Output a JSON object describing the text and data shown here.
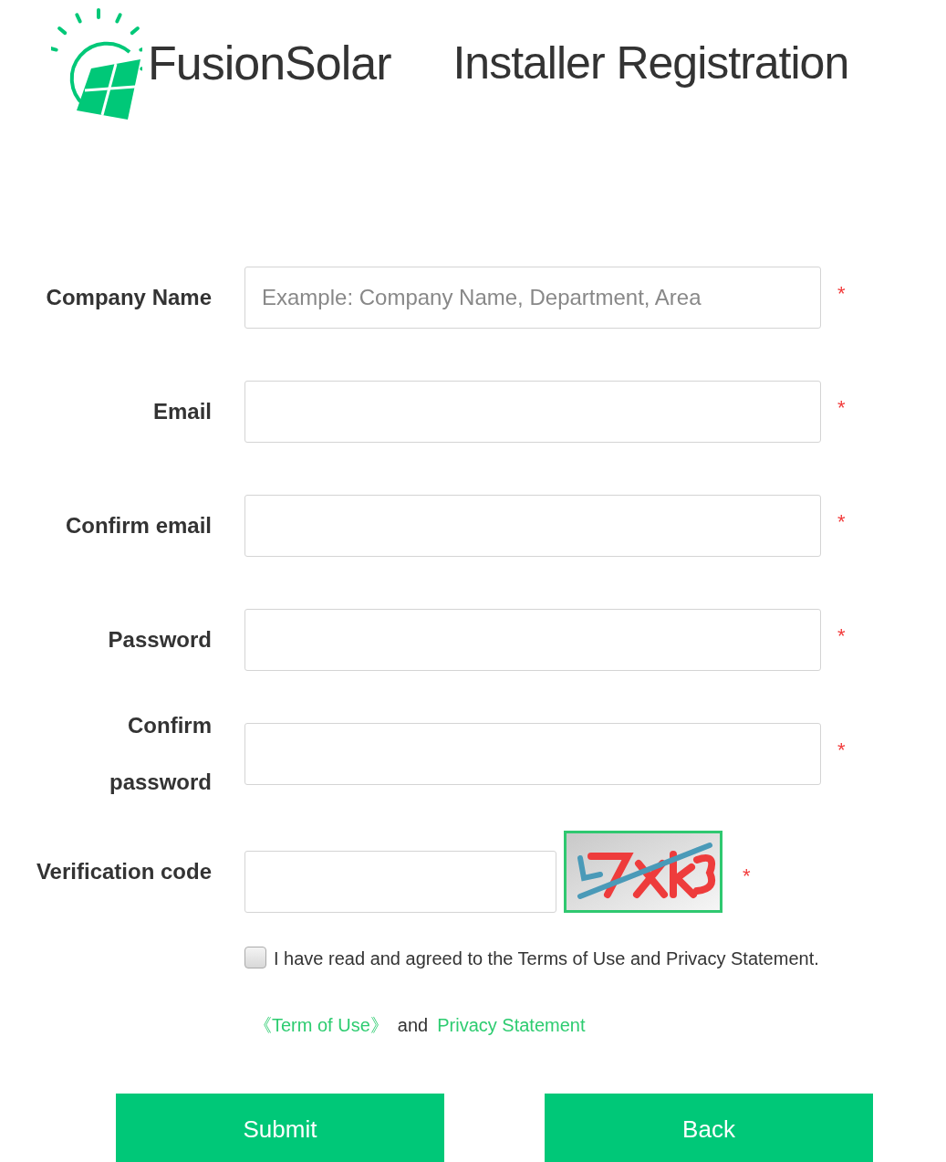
{
  "header": {
    "brand": "FusionSolar",
    "title": "Installer Registration"
  },
  "fields": [
    {
      "label": "Company Name",
      "placeholder": "Example: Company Name, Department, Area",
      "required_mark": "*"
    },
    {
      "label": "Email",
      "required_mark": "*"
    },
    {
      "label": "Confirm email",
      "required_mark": "*"
    },
    {
      "label": "Password",
      "required_mark": "*"
    },
    {
      "label": "Confirm password",
      "required_mark": "*"
    }
  ],
  "verification": {
    "label": "Verification code",
    "required_mark": "*"
  },
  "agreement": {
    "checked": false,
    "text": "I have read and agreed to the Terms of Use and Privacy Statement.",
    "terms_link": "《Term of Use》",
    "joiner": "and",
    "privacy_link": "Privacy Statement"
  },
  "buttons": [
    "Submit",
    "Back"
  ]
}
